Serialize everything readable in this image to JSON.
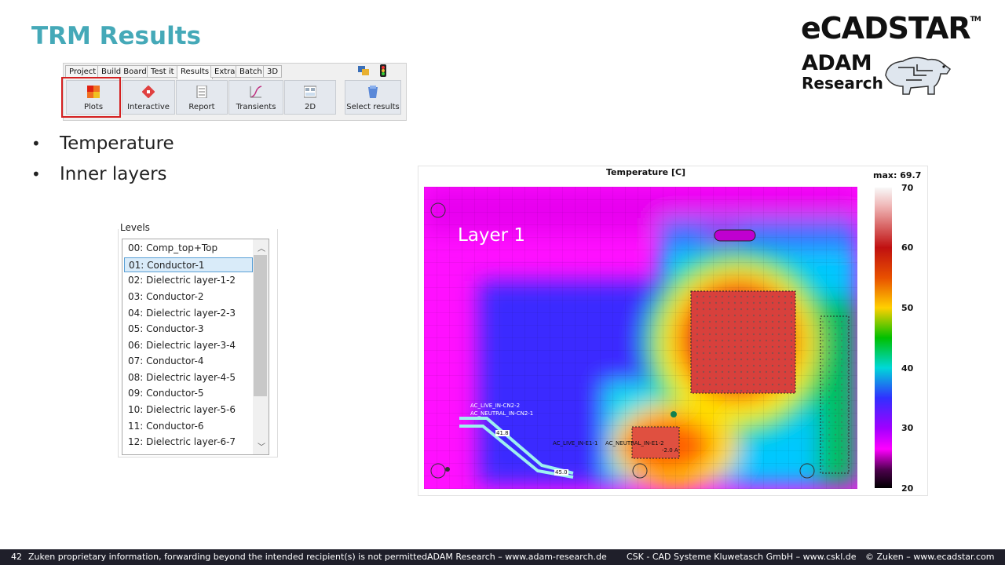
{
  "slide": {
    "title": "TRM Results",
    "bullets": [
      "Temperature",
      "Inner layers"
    ]
  },
  "logo": {
    "ecadstar": "eCADSTAR",
    "ecadstar_tm": "TM",
    "adam_line1": "ADAM",
    "adam_line2": "Research"
  },
  "ribbon": {
    "tabs": [
      "Project",
      "Build Board",
      "Test it",
      "Results",
      "Extra",
      "Batch",
      "3D"
    ],
    "active_tab": "Results",
    "buttons": [
      "Plots",
      "Interactive",
      "Report",
      "Transients",
      "2D",
      "Select results"
    ],
    "highlighted_button": "Plots"
  },
  "levels": {
    "caption": "Levels",
    "items": [
      "00: Comp_top+Top",
      "01: Conductor-1",
      "02: Dielectric layer-1-2",
      "03: Conductor-2",
      "04: Dielectric layer-2-3",
      "05: Conductor-3",
      "06: Dielectric layer-3-4",
      "07: Conductor-4",
      "08: Dielectric layer-4-5",
      "09: Conductor-5",
      "10: Dielectric layer-5-6",
      "11: Conductor-6",
      "12: Dielectric layer-6-7"
    ],
    "selected": "01: Conductor-1"
  },
  "plot": {
    "title": "Temperature [C]",
    "max_label": "max:  69.7",
    "layer_label": "Layer 1",
    "colorbar_ticks": [
      "70",
      "60",
      "50",
      "40",
      "30",
      "20"
    ],
    "colorbar_range": [
      20,
      70
    ],
    "annotations": [
      "41.8",
      "45.0"
    ],
    "net_labels": [
      "AC_LIVE_IN-CN2-2",
      "AC_NEUTRAL_IN-CN2-1",
      "AC_LIVE_IN-E1-1",
      "AC_NEUTRAL_IN-E1-2",
      "-2.0 A"
    ]
  },
  "footer": {
    "page": "42",
    "notice": "Zuken proprietary information, forwarding beyond the intended recipient(s) is not permitted.",
    "adam": "ADAM Research – www.adam-research.de",
    "csk": "CSK - CAD Systeme Kluwetasch GmbH – www.cskl.de",
    "zuken": "© Zuken – www.ecadstar.com"
  },
  "colors": {
    "title": "#45a9b8",
    "footer_bg": "#1f1f2a",
    "highlight": "#d42020",
    "selection": "#d9ebf9"
  }
}
